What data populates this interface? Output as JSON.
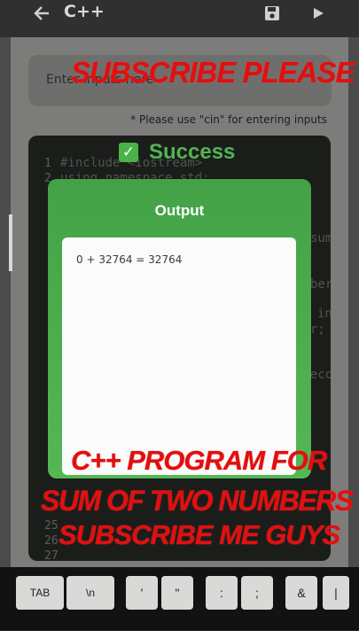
{
  "app": {
    "title": "C++"
  },
  "topbar": {
    "back_icon": "arrow-left-icon",
    "save_icon": "floppy-disk-icon",
    "run_icon": "play-icon"
  },
  "input": {
    "placeholder": "Enter inputs here"
  },
  "hint": "* Please use \"cin\" for entering inputs",
  "editor": {
    "line_numbers": [
      "1",
      "2",
      "25",
      "26",
      "27"
    ],
    "code_lines": [
      "#include <iostream>",
      "using namespace std;",
      "sum",
      "ber",
      "in",
      "r;",
      "eco"
    ]
  },
  "status": {
    "success_text": "Success"
  },
  "output": {
    "title": "Output",
    "text": "0 + 32764 = 32764"
  },
  "overlays": {
    "top": "SUBSCRIBE PLEASE",
    "line1": "C++ PROGRAM FOR",
    "line2": "SUM OF TWO NUMBERS",
    "line3": "SUBSCRIBE ME GUYS"
  },
  "keyboard": {
    "keys": [
      "TAB",
      "\\n",
      "'",
      "\"",
      ":",
      ";",
      "&",
      "|"
    ]
  },
  "colors": {
    "success": "#4caf50",
    "overlay": "#e01010"
  }
}
